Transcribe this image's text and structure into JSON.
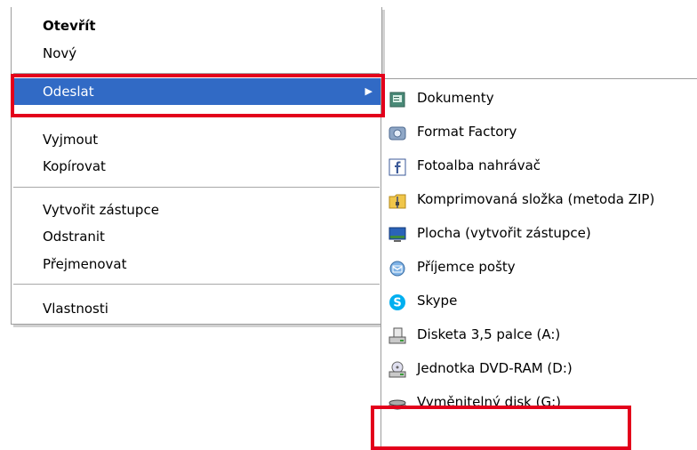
{
  "context_menu": {
    "items": [
      {
        "label": "Otevřít"
      },
      {
        "label": "Nový"
      },
      {
        "label": "Odeslat"
      },
      {
        "label": "Vyjmout"
      },
      {
        "label": "Kopírovat"
      },
      {
        "label": "Vytvořit zástupce"
      },
      {
        "label": "Odstranit"
      },
      {
        "label": "Přejmenovat"
      },
      {
        "label": "Vlastnosti"
      }
    ],
    "submenu_arrow": "▶"
  },
  "send_to_submenu": {
    "items": [
      {
        "label": "Dokumenty",
        "icon": "documents-folder-icon"
      },
      {
        "label": "Format Factory",
        "icon": "format-factory-icon"
      },
      {
        "label": "Fotoalba nahrávač",
        "icon": "facebook-icon"
      },
      {
        "label": "Komprimovaná složka (metoda ZIP)",
        "icon": "zip-folder-icon"
      },
      {
        "label": "Plocha (vytvořit zástupce)",
        "icon": "desktop-icon"
      },
      {
        "label": "Příjemce pošty",
        "icon": "mail-recipient-icon"
      },
      {
        "label": "Skype",
        "icon": "skype-icon"
      },
      {
        "label": "Disketa 3,5 palce (A:)",
        "icon": "floppy-drive-icon"
      },
      {
        "label": "Jednotka DVD-RAM (D:)",
        "icon": "dvd-drive-icon"
      },
      {
        "label": "Vyměnitelný disk (G:)",
        "icon": "removable-disk-icon"
      }
    ]
  },
  "colors": {
    "selection": "#316ac5",
    "highlight_outline": "#e3001b"
  }
}
